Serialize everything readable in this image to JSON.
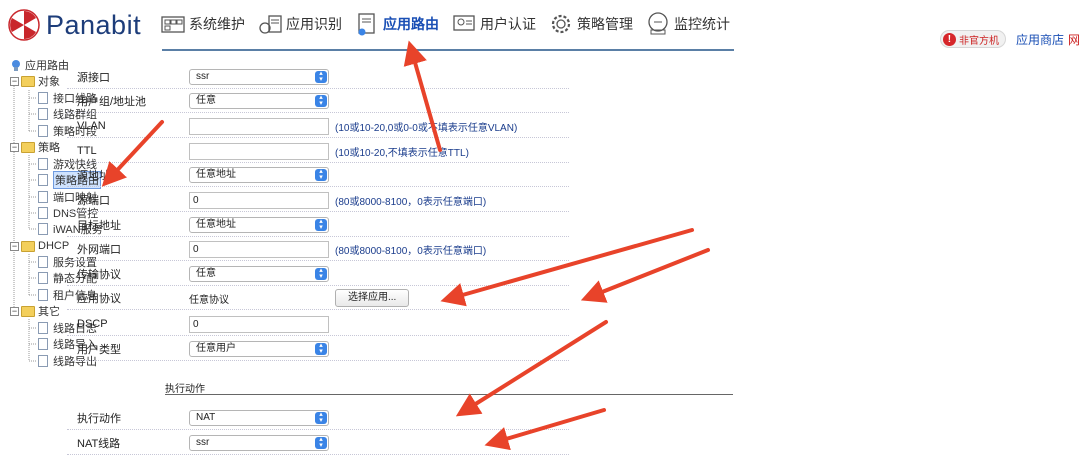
{
  "brand": {
    "name": "Panabit"
  },
  "nav": {
    "items": [
      {
        "label": "系统维护",
        "icon": "system-maintenance-icon"
      },
      {
        "label": "应用识别",
        "icon": "app-identify-icon"
      },
      {
        "label": "应用路由",
        "icon": "app-routing-icon",
        "active": true
      },
      {
        "label": "用户认证",
        "icon": "user-auth-icon"
      },
      {
        "label": "策略管理",
        "icon": "policy-gear-icon"
      },
      {
        "label": "监控统计",
        "icon": "monitor-icon"
      }
    ]
  },
  "topbar": {
    "badge": "非官方机",
    "store": "应用商店",
    "extra": "网"
  },
  "sidebar": {
    "root": "应用路由",
    "groups": [
      {
        "label": "对象",
        "items": [
          "接口线路",
          "线路群组",
          "策略时段"
        ]
      },
      {
        "label": "策略",
        "items": [
          "游戏快线",
          "策略路由",
          "端口映射",
          "DNS管控",
          "iWAN服务"
        ]
      },
      {
        "label": "DHCP",
        "items": [
          "服务设置",
          "静态分配",
          "租户信息"
        ]
      },
      {
        "label": "其它",
        "items": [
          "线路日志",
          "线路导入",
          "线路导出"
        ]
      }
    ],
    "selected": "策略路由"
  },
  "form": {
    "src_interface": {
      "label": "源接口",
      "value": "ssr"
    },
    "user_group": {
      "label": "用户组/地址池",
      "value": "任意"
    },
    "vlan": {
      "label": "VLAN",
      "value": "",
      "hint": "(10或10-20,0或0-0或不填表示任意VLAN)"
    },
    "ttl": {
      "label": "TTL",
      "value": "",
      "hint": "(10或10-20,不填表示任意TTL)"
    },
    "src_addr": {
      "label": "源地址",
      "value": "任意地址"
    },
    "src_port": {
      "label": "源端口",
      "value": "0",
      "hint": "(80或8000-8100，0表示任意端口)"
    },
    "dst_addr": {
      "label": "目标地址",
      "value": "任意地址"
    },
    "wan_port": {
      "label": "外网端口",
      "value": "0",
      "hint": "(80或8000-8100，0表示任意端口)"
    },
    "protocol": {
      "label": "传输协议",
      "value": "任意"
    },
    "app_protocol": {
      "label": "应用协议",
      "value": "任意协议",
      "button": "选择应用..."
    },
    "dscp": {
      "label": "DSCP",
      "value": "0"
    },
    "user_type": {
      "label": "用户类型",
      "value": "任意用户"
    }
  },
  "action": {
    "section_title": "执行动作",
    "action": {
      "label": "执行动作",
      "value": "NAT"
    },
    "nat_line": {
      "label": "NAT线路",
      "value": "ssr"
    }
  },
  "colors": {
    "brand": "#1d3d7a",
    "accent": "#3a84e6",
    "arrow": "#e8432a",
    "hint": "#1a3c8c"
  }
}
